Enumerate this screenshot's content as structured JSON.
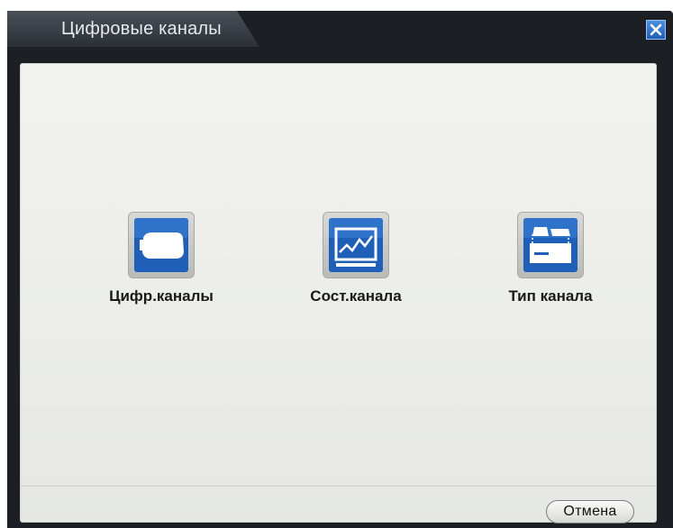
{
  "window": {
    "title": "Цифровые каналы",
    "close_icon": "close-icon"
  },
  "tiles": [
    {
      "label": "Цифр.каналы",
      "icon": "camera-icon"
    },
    {
      "label": "Сост.канала",
      "icon": "chart-icon"
    },
    {
      "label": "Тип канала",
      "icon": "channel-type-icon"
    }
  ],
  "footer": {
    "cancel_label": "Отмена"
  },
  "colors": {
    "titlebar": "#1c1f24",
    "icon_blue": "#1f5fb8",
    "content_bg": "#eeeeeb"
  }
}
